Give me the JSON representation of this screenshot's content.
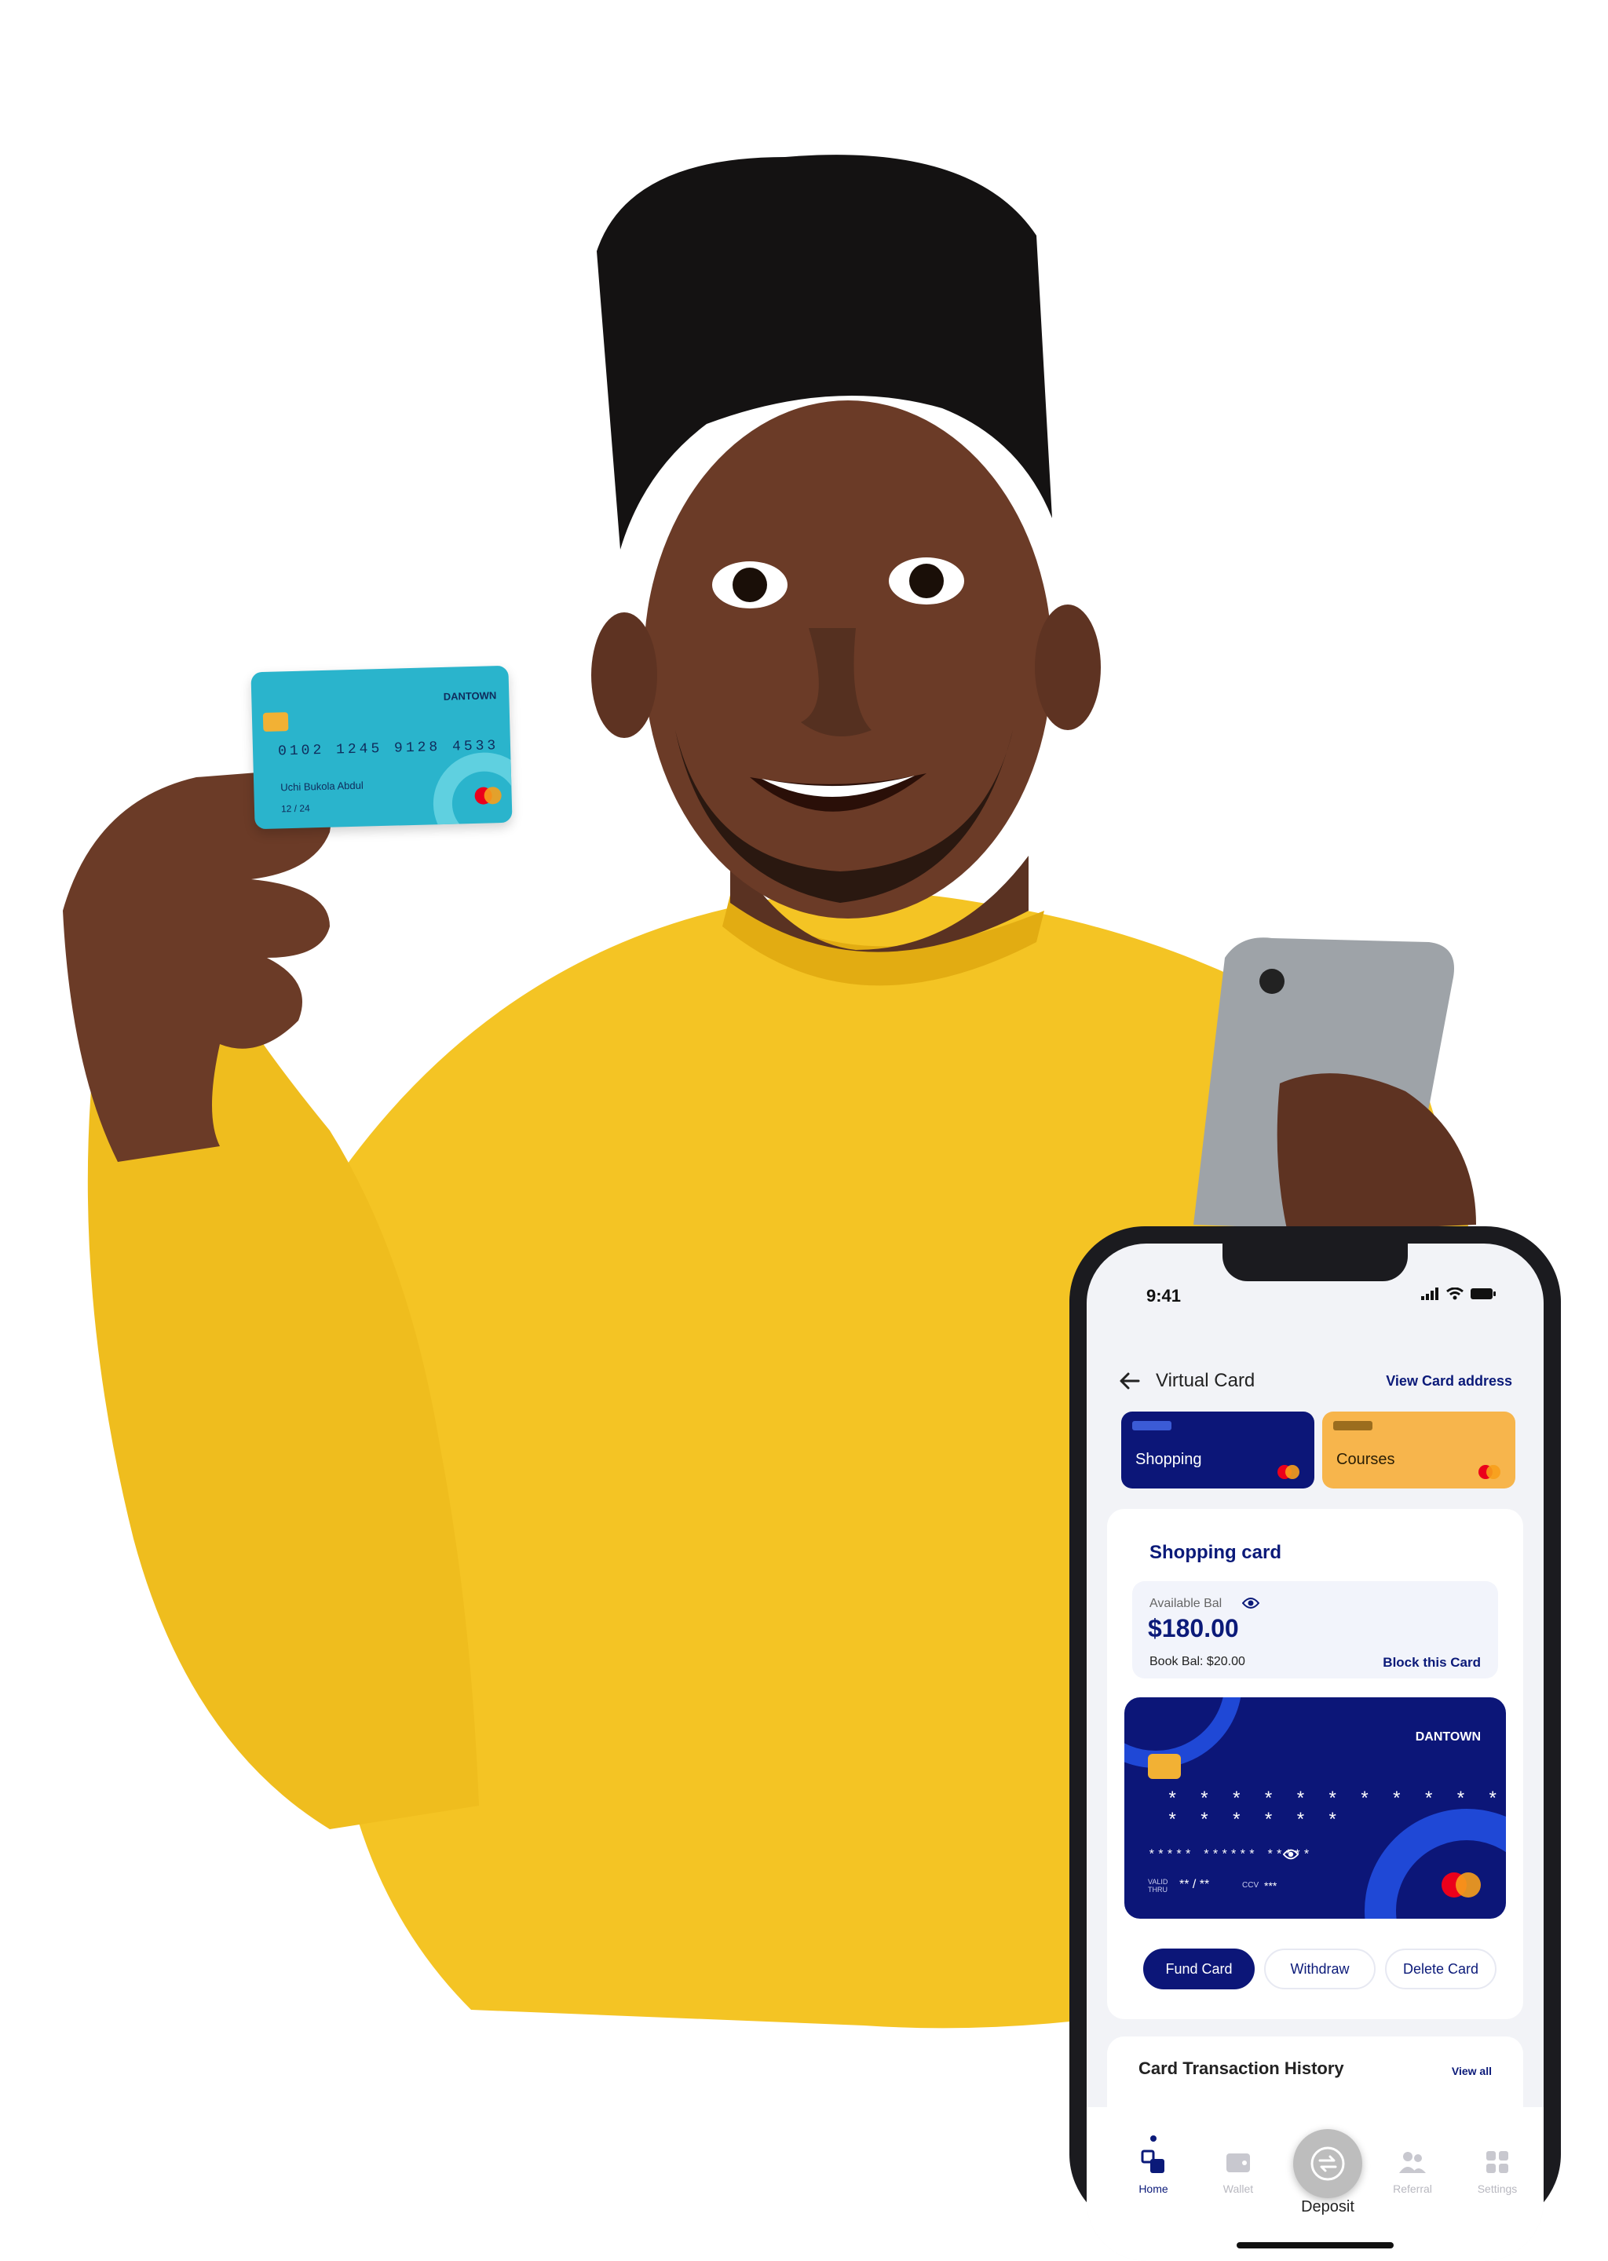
{
  "held_card": {
    "brand": "DANTOWN",
    "number": "0102 1245 9128 4533",
    "holder": "Uchi Bukola Abdul",
    "expiry": "12 / 24"
  },
  "status_bar": {
    "time": "9:41"
  },
  "header": {
    "title": "Virtual Card",
    "link": "View Card address"
  },
  "card_tabs": [
    {
      "label": "Shopping",
      "color": "#0c1678"
    },
    {
      "label": "Courses",
      "color": "#f7b54c"
    }
  ],
  "panel": {
    "title": "Shopping card",
    "available_label": "Available Bal",
    "available_value": "$180.00",
    "book_balance": "Book Bal: $20.00",
    "block_link": "Block this Card"
  },
  "virtual_card": {
    "brand": "DANTOWN",
    "masked_number": "* * * * *   * * * *   * * * *   * * * *",
    "masked_number_short": "***** ****** *****",
    "valid_label": "VALID THRU",
    "valid_value": "** / **",
    "ccv_label": "CCV",
    "ccv_value": "***"
  },
  "actions": {
    "fund": "Fund Card",
    "withdraw": "Withdraw",
    "delete": "Delete Card"
  },
  "history": {
    "title": "Card Transaction History",
    "link": "View all"
  },
  "nav": {
    "home": "Home",
    "wallet": "Wallet",
    "deposit": "Deposit",
    "referral": "Referral",
    "settings": "Settings"
  },
  "colors": {
    "accent_navy": "#0c1678",
    "accent_orange": "#f7b54c",
    "sweater": "#f4c424",
    "card_teal": "#2ab4cc"
  }
}
